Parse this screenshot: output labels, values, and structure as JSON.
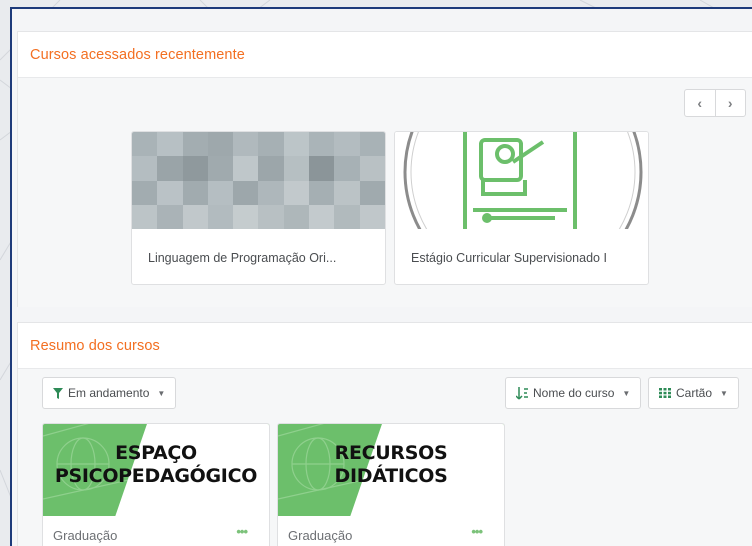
{
  "recent": {
    "title": "Cursos acessados recentemente",
    "prev_icon": "chevron-left-icon",
    "next_icon": "chevron-right-icon",
    "prev_glyph": "‹",
    "next_glyph": "›",
    "courses": [
      {
        "name": "Linguagem de Programação Ori..."
      },
      {
        "name": "Estágio Curricular Supervisionado I"
      }
    ]
  },
  "summary": {
    "title": "Resumo dos cursos",
    "filter": {
      "icon": "filter-icon",
      "label": "Em andamento"
    },
    "sort": {
      "icon": "sort-alpha-icon",
      "label": "Nome do curso"
    },
    "view": {
      "icon": "grid-icon",
      "label": "Cartão"
    },
    "courses": [
      {
        "image_title_line1": "ESPAÇO",
        "image_title_line2": "PSICOPEDAGÓGICO",
        "category": "Graduação"
      },
      {
        "image_title_line1": "RECURSOS",
        "image_title_line2": "DIDÁTICOS",
        "category": "Graduação"
      }
    ]
  },
  "colors": {
    "accent": "#f36f21",
    "course_green": "#6cbf6b",
    "frame": "#1d3a7a"
  }
}
